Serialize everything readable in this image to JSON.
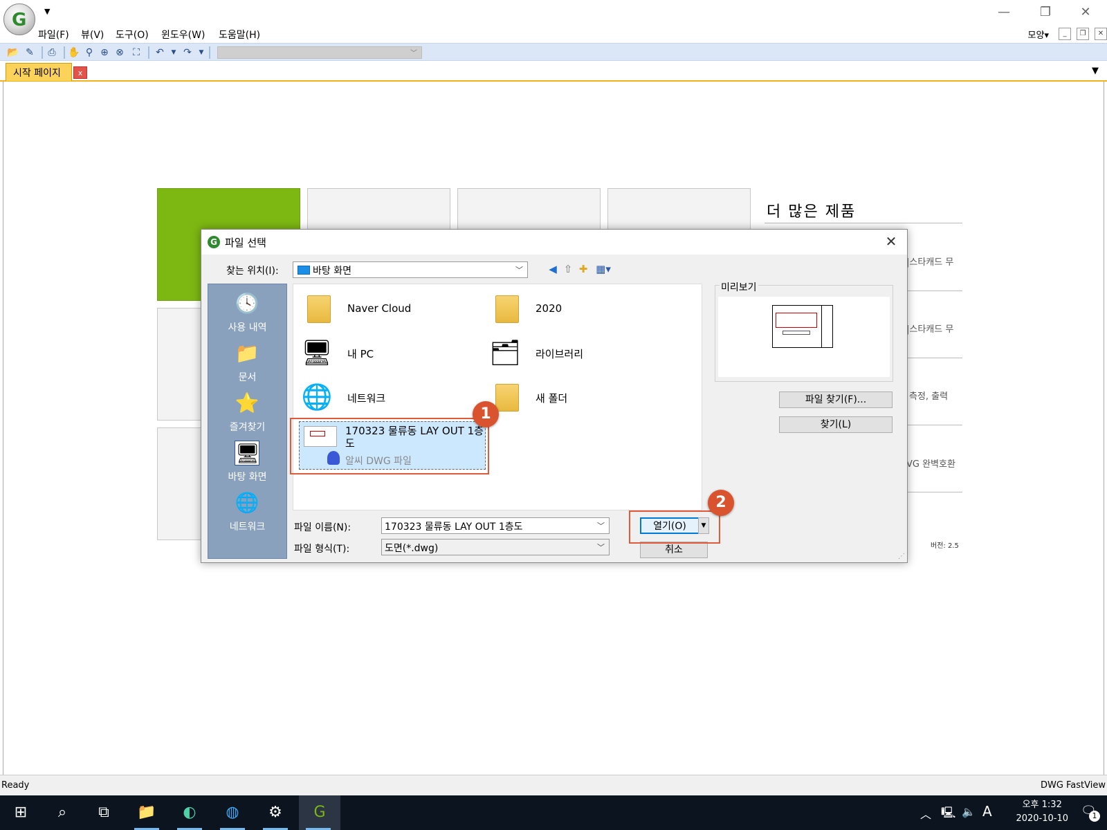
{
  "app": {
    "logo_letter": "G",
    "menu": [
      "파일(F)",
      "뷰(V)",
      "도구(O)",
      "윈도우(W)",
      "도움말(H)"
    ],
    "shape_menu": "모양▾",
    "tab_label": "시작 페이지",
    "tab_close": "x"
  },
  "start_page": {
    "more_products_title": "더 많은 제품",
    "product_snippets": [
      "|스타캐드 무",
      "|스타캐드 무",
      "측정, 출력",
      "VG 완벽호환"
    ],
    "version": "버전: 2.5"
  },
  "dialog": {
    "title": "파일 선택",
    "logo_letter": "G",
    "look_in_label": "찾는 위치(I):",
    "look_in_value": "바탕 화면",
    "places": [
      {
        "label": "사용 내역",
        "icon": "history-icon"
      },
      {
        "label": "문서",
        "icon": "documents-icon"
      },
      {
        "label": "즐겨찾기",
        "icon": "favorites-icon"
      },
      {
        "label": "바탕 화면",
        "icon": "desktop-icon"
      },
      {
        "label": "네트워크",
        "icon": "network-icon"
      }
    ],
    "items": [
      {
        "name": "Naver Cloud",
        "icon": "folder-icon"
      },
      {
        "name": "2020",
        "icon": "user-folder-icon"
      },
      {
        "name": "내 PC",
        "icon": "computer-icon"
      },
      {
        "name": "라이브러리",
        "icon": "library-icon"
      },
      {
        "name": "네트워크",
        "icon": "network-icon"
      },
      {
        "name": "새 폴더",
        "icon": "folder-icon"
      }
    ],
    "selected_file": {
      "name": "170323 물류동 LAY OUT 1층도",
      "type": "알씨 DWG 파일"
    },
    "preview_label": "미리보기",
    "find_file_button": "파일 찾기(F)...",
    "search_button": "찾기(L)",
    "file_name_label": "파일 이름(N):",
    "file_name_value": "170323 물류동 LAY OUT 1층도",
    "file_type_label": "파일 형식(T):",
    "file_type_value": "도면(*.dwg)",
    "open_button": "열기(O)",
    "cancel_button": "취소",
    "markers": [
      "1",
      "2"
    ]
  },
  "status": {
    "left": "Ready",
    "right": "DWG FastView"
  },
  "taskbar": {
    "clock_time": "오후 1:32",
    "clock_date": "2020-10-10",
    "ime": "A",
    "notification_count": "1"
  },
  "colors": {
    "accent_green": "#7db812",
    "tab_yellow": "#fbd25a",
    "highlight_red": "#e05a3c",
    "selection_blue": "#cce8ff"
  }
}
